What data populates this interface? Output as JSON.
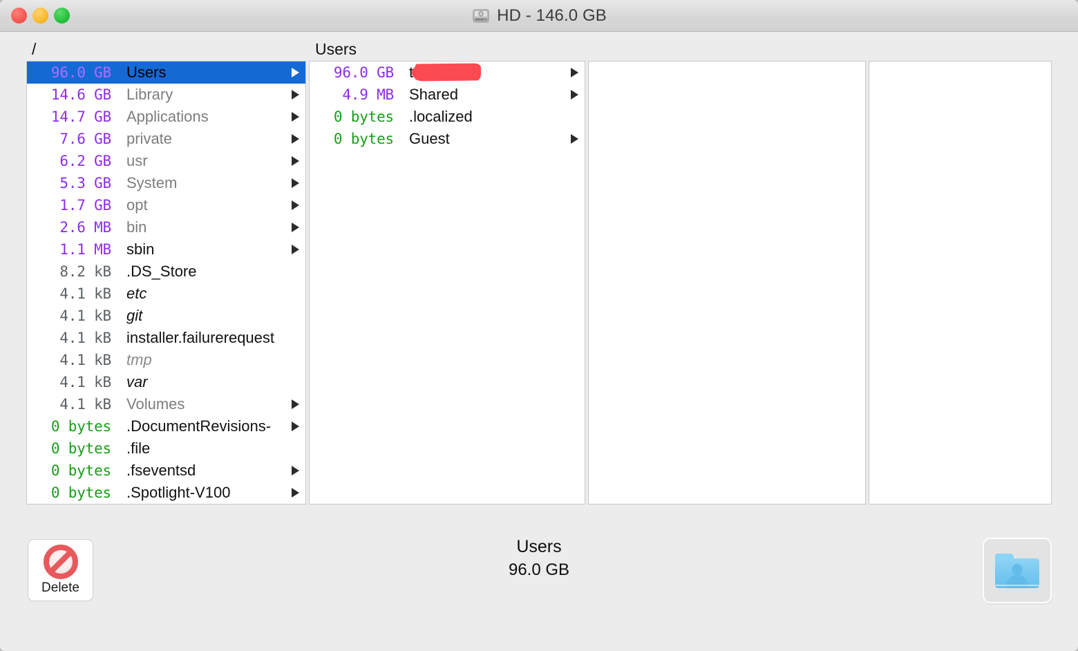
{
  "window": {
    "title": "HD - 146.0 GB",
    "drive_icon": "hard-drive-icon",
    "traffic_lights": {
      "close_color": "#f75b55",
      "minimize_color": "#fbbd2e",
      "maximize_color": "#29c33f"
    }
  },
  "colors": {
    "selection": "#1569d4",
    "size_large": "#8e2ee8",
    "size_small": "#5b6166",
    "size_zero": "#1a9d1a",
    "redaction": "#fc4a52",
    "chrome": "#ececec"
  },
  "columns": [
    {
      "header": "/"
    },
    {
      "header": "Users"
    },
    {
      "header": ""
    },
    {
      "header": ""
    }
  ],
  "panes": [
    {
      "name": "root-pane",
      "rows": [
        {
          "size": "96.0 GB",
          "size_class": "purple",
          "name": "Users",
          "name_class": "",
          "arrow": true,
          "selected": true
        },
        {
          "size": "14.6 GB",
          "size_class": "purple",
          "name": "Library",
          "name_class": "dim",
          "arrow": true,
          "selected": false
        },
        {
          "size": "14.7 GB",
          "size_class": "purple",
          "name": "Applications",
          "name_class": "dim",
          "arrow": true,
          "selected": false
        },
        {
          "size": "7.6 GB",
          "size_class": "purple",
          "name": "private",
          "name_class": "dim",
          "arrow": true,
          "selected": false
        },
        {
          "size": "6.2 GB",
          "size_class": "purple",
          "name": "usr",
          "name_class": "dim",
          "arrow": true,
          "selected": false
        },
        {
          "size": "5.3 GB",
          "size_class": "purple",
          "name": "System",
          "name_class": "dim",
          "arrow": true,
          "selected": false
        },
        {
          "size": "1.7 GB",
          "size_class": "purple",
          "name": "opt",
          "name_class": "dim",
          "arrow": true,
          "selected": false
        },
        {
          "size": "2.6 MB",
          "size_class": "purple",
          "name": "bin",
          "name_class": "dim",
          "arrow": true,
          "selected": false
        },
        {
          "size": "1.1 MB",
          "size_class": "purple",
          "name": "sbin",
          "name_class": "",
          "arrow": true,
          "selected": false
        },
        {
          "size": "8.2 kB",
          "size_class": "gray",
          "name": ".DS_Store",
          "name_class": "",
          "arrow": false,
          "selected": false
        },
        {
          "size": "4.1 kB",
          "size_class": "gray",
          "name": "etc",
          "name_class": "italic",
          "arrow": false,
          "selected": false
        },
        {
          "size": "4.1 kB",
          "size_class": "gray",
          "name": "git",
          "name_class": "italic",
          "arrow": false,
          "selected": false
        },
        {
          "size": "4.1 kB",
          "size_class": "gray",
          "name": "installer.failurerequest",
          "name_class": "",
          "arrow": false,
          "selected": false
        },
        {
          "size": "4.1 kB",
          "size_class": "gray",
          "name": "tmp",
          "name_class": "dimital",
          "arrow": false,
          "selected": false
        },
        {
          "size": "4.1 kB",
          "size_class": "gray",
          "name": "var",
          "name_class": "italic",
          "arrow": false,
          "selected": false
        },
        {
          "size": "4.1 kB",
          "size_class": "gray",
          "name": "Volumes",
          "name_class": "dim",
          "arrow": true,
          "selected": false
        },
        {
          "size": "0 bytes",
          "size_class": "green",
          "name": ".DocumentRevisions-",
          "name_class": "",
          "arrow": true,
          "selected": false
        },
        {
          "size": "0 bytes",
          "size_class": "green",
          "name": ".file",
          "name_class": "",
          "arrow": false,
          "selected": false
        },
        {
          "size": "0 bytes",
          "size_class": "green",
          "name": ".fseventsd",
          "name_class": "",
          "arrow": true,
          "selected": false
        },
        {
          "size": "0 bytes",
          "size_class": "green",
          "name": ".Spotlight-V100",
          "name_class": "",
          "arrow": true,
          "selected": false
        }
      ]
    },
    {
      "name": "users-pane",
      "rows": [
        {
          "size": "96.0 GB",
          "size_class": "purple",
          "name": "t",
          "name_class": "",
          "arrow": true,
          "selected": false,
          "redacted": true
        },
        {
          "size": "4.9 MB",
          "size_class": "purple",
          "name": "Shared",
          "name_class": "",
          "arrow": true,
          "selected": false
        },
        {
          "size": "0 bytes",
          "size_class": "green",
          "name": ".localized",
          "name_class": "",
          "arrow": false,
          "selected": false
        },
        {
          "size": "0 bytes",
          "size_class": "green",
          "name": "Guest",
          "name_class": "",
          "arrow": true,
          "selected": false
        }
      ]
    },
    {
      "name": "empty-pane-3",
      "rows": []
    },
    {
      "name": "empty-pane-4",
      "rows": []
    }
  ],
  "bottom": {
    "delete_label": "Delete",
    "delete_icon": "no-entry-icon",
    "status_name": "Users",
    "status_size": "96.0 GB",
    "folder_icon": "users-folder-icon"
  }
}
